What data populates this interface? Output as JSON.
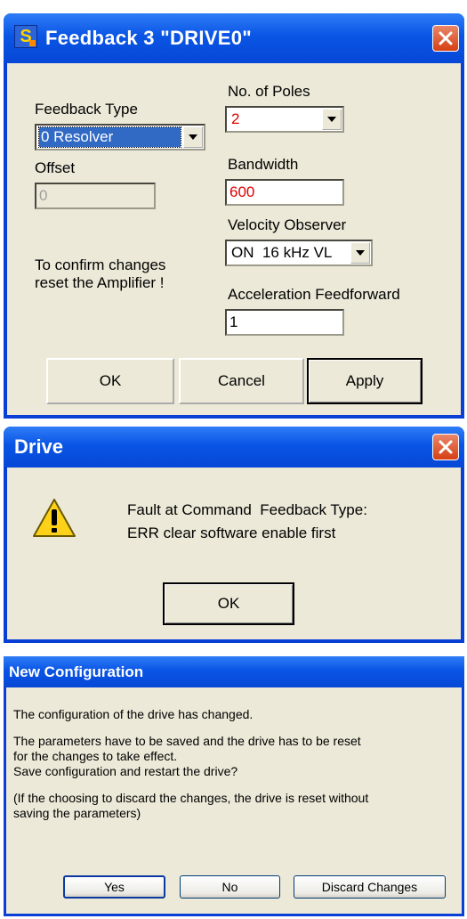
{
  "feedback": {
    "title": "Feedback 3 \"DRIVE0\"",
    "app_icon_letter": "S",
    "feedback_type_label": "Feedback Type",
    "feedback_type_value": "0 Resolver",
    "poles_label": "No. of Poles",
    "poles_value": "2",
    "offset_label": "Offset",
    "offset_value": "0",
    "bandwidth_label": "Bandwidth",
    "bandwidth_value": "600",
    "velocity_label": "Velocity Observer",
    "velocity_value": "ON  16 kHz VL",
    "confirm_line1": "To confirm changes",
    "confirm_line2": "reset the Amplifier !",
    "accel_label": "Acceleration Feedforward",
    "accel_value": "1",
    "ok_label": "OK",
    "cancel_label": "Cancel",
    "apply_label": "Apply"
  },
  "drive": {
    "title": "Drive",
    "line1": "Fault at Command  Feedback Type:",
    "line2": "ERR clear software enable first",
    "ok_label": "OK"
  },
  "newconfig": {
    "title": "New Configuration",
    "p1": "The configuration of the drive has changed.",
    "p2a": "The parameters have to be saved and the drive has to be reset",
    "p2b": "for the changes to take effect.",
    "p2c": "Save configuration and restart the drive?",
    "p3a": "(If the choosing to discard the changes, the drive is reset without",
    "p3b": "saving the parameters)",
    "yes_label": "Yes",
    "no_label": "No",
    "discard_label": "Discard Changes"
  },
  "colors": {
    "titlebar": "#0a55e5",
    "dialog_bg": "#ece9d8",
    "red_value": "#e00000",
    "selection": "#316ac5"
  }
}
